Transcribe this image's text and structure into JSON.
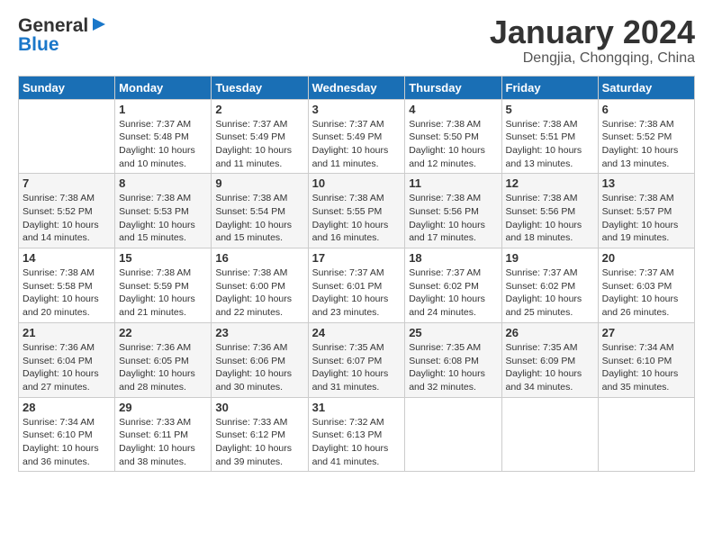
{
  "header": {
    "logo_general": "General",
    "logo_blue": "Blue",
    "month_title": "January 2024",
    "location": "Dengjia, Chongqing, China"
  },
  "days_of_week": [
    "Sunday",
    "Monday",
    "Tuesday",
    "Wednesday",
    "Thursday",
    "Friday",
    "Saturday"
  ],
  "weeks": [
    [
      {
        "num": "",
        "info": ""
      },
      {
        "num": "1",
        "info": "Sunrise: 7:37 AM\nSunset: 5:48 PM\nDaylight: 10 hours\nand 10 minutes."
      },
      {
        "num": "2",
        "info": "Sunrise: 7:37 AM\nSunset: 5:49 PM\nDaylight: 10 hours\nand 11 minutes."
      },
      {
        "num": "3",
        "info": "Sunrise: 7:37 AM\nSunset: 5:49 PM\nDaylight: 10 hours\nand 11 minutes."
      },
      {
        "num": "4",
        "info": "Sunrise: 7:38 AM\nSunset: 5:50 PM\nDaylight: 10 hours\nand 12 minutes."
      },
      {
        "num": "5",
        "info": "Sunrise: 7:38 AM\nSunset: 5:51 PM\nDaylight: 10 hours\nand 13 minutes."
      },
      {
        "num": "6",
        "info": "Sunrise: 7:38 AM\nSunset: 5:52 PM\nDaylight: 10 hours\nand 13 minutes."
      }
    ],
    [
      {
        "num": "7",
        "info": "Sunrise: 7:38 AM\nSunset: 5:52 PM\nDaylight: 10 hours\nand 14 minutes."
      },
      {
        "num": "8",
        "info": "Sunrise: 7:38 AM\nSunset: 5:53 PM\nDaylight: 10 hours\nand 15 minutes."
      },
      {
        "num": "9",
        "info": "Sunrise: 7:38 AM\nSunset: 5:54 PM\nDaylight: 10 hours\nand 15 minutes."
      },
      {
        "num": "10",
        "info": "Sunrise: 7:38 AM\nSunset: 5:55 PM\nDaylight: 10 hours\nand 16 minutes."
      },
      {
        "num": "11",
        "info": "Sunrise: 7:38 AM\nSunset: 5:56 PM\nDaylight: 10 hours\nand 17 minutes."
      },
      {
        "num": "12",
        "info": "Sunrise: 7:38 AM\nSunset: 5:56 PM\nDaylight: 10 hours\nand 18 minutes."
      },
      {
        "num": "13",
        "info": "Sunrise: 7:38 AM\nSunset: 5:57 PM\nDaylight: 10 hours\nand 19 minutes."
      }
    ],
    [
      {
        "num": "14",
        "info": "Sunrise: 7:38 AM\nSunset: 5:58 PM\nDaylight: 10 hours\nand 20 minutes."
      },
      {
        "num": "15",
        "info": "Sunrise: 7:38 AM\nSunset: 5:59 PM\nDaylight: 10 hours\nand 21 minutes."
      },
      {
        "num": "16",
        "info": "Sunrise: 7:38 AM\nSunset: 6:00 PM\nDaylight: 10 hours\nand 22 minutes."
      },
      {
        "num": "17",
        "info": "Sunrise: 7:37 AM\nSunset: 6:01 PM\nDaylight: 10 hours\nand 23 minutes."
      },
      {
        "num": "18",
        "info": "Sunrise: 7:37 AM\nSunset: 6:02 PM\nDaylight: 10 hours\nand 24 minutes."
      },
      {
        "num": "19",
        "info": "Sunrise: 7:37 AM\nSunset: 6:02 PM\nDaylight: 10 hours\nand 25 minutes."
      },
      {
        "num": "20",
        "info": "Sunrise: 7:37 AM\nSunset: 6:03 PM\nDaylight: 10 hours\nand 26 minutes."
      }
    ],
    [
      {
        "num": "21",
        "info": "Sunrise: 7:36 AM\nSunset: 6:04 PM\nDaylight: 10 hours\nand 27 minutes."
      },
      {
        "num": "22",
        "info": "Sunrise: 7:36 AM\nSunset: 6:05 PM\nDaylight: 10 hours\nand 28 minutes."
      },
      {
        "num": "23",
        "info": "Sunrise: 7:36 AM\nSunset: 6:06 PM\nDaylight: 10 hours\nand 30 minutes."
      },
      {
        "num": "24",
        "info": "Sunrise: 7:35 AM\nSunset: 6:07 PM\nDaylight: 10 hours\nand 31 minutes."
      },
      {
        "num": "25",
        "info": "Sunrise: 7:35 AM\nSunset: 6:08 PM\nDaylight: 10 hours\nand 32 minutes."
      },
      {
        "num": "26",
        "info": "Sunrise: 7:35 AM\nSunset: 6:09 PM\nDaylight: 10 hours\nand 34 minutes."
      },
      {
        "num": "27",
        "info": "Sunrise: 7:34 AM\nSunset: 6:10 PM\nDaylight: 10 hours\nand 35 minutes."
      }
    ],
    [
      {
        "num": "28",
        "info": "Sunrise: 7:34 AM\nSunset: 6:10 PM\nDaylight: 10 hours\nand 36 minutes."
      },
      {
        "num": "29",
        "info": "Sunrise: 7:33 AM\nSunset: 6:11 PM\nDaylight: 10 hours\nand 38 minutes."
      },
      {
        "num": "30",
        "info": "Sunrise: 7:33 AM\nSunset: 6:12 PM\nDaylight: 10 hours\nand 39 minutes."
      },
      {
        "num": "31",
        "info": "Sunrise: 7:32 AM\nSunset: 6:13 PM\nDaylight: 10 hours\nand 41 minutes."
      },
      {
        "num": "",
        "info": ""
      },
      {
        "num": "",
        "info": ""
      },
      {
        "num": "",
        "info": ""
      }
    ]
  ]
}
